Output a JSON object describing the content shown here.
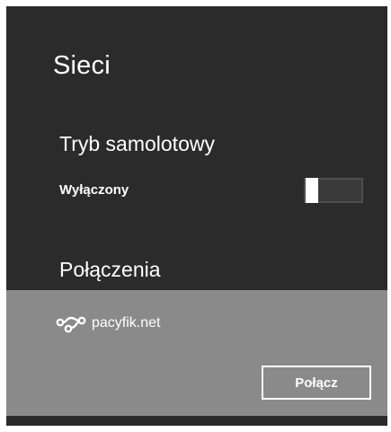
{
  "panel": {
    "title": "Sieci",
    "airplane_mode": {
      "heading": "Tryb samolotowy",
      "state_label": "Wyłączony",
      "enabled": false
    },
    "connections": {
      "heading": "Połączenia",
      "networks": [
        {
          "name": "pacyfik.net",
          "icon": "wired-network-icon",
          "button_label": "Połącz"
        }
      ]
    }
  },
  "colors": {
    "panel_background": "#2b2b2b",
    "selected_item_background": "#8a8a8a",
    "toggle_track": "#3a3a3a",
    "text": "#ffffff"
  }
}
